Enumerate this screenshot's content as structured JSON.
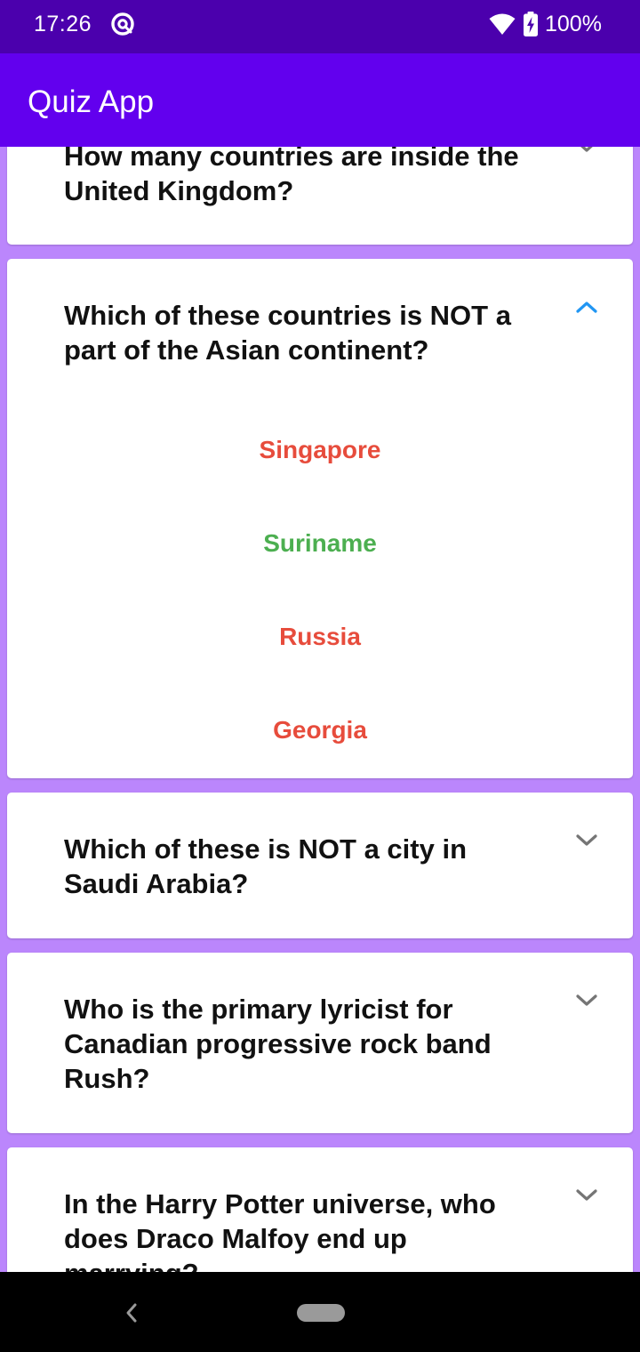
{
  "status_bar": {
    "time": "17:26",
    "battery": "100%",
    "app_icon": "at-sign-icon",
    "wifi_icon": "wifi-icon",
    "battery_icon": "battery-charging-icon"
  },
  "app_bar": {
    "title": "Quiz App"
  },
  "questions": [
    {
      "text": "How many countries are inside the United Kingdom?",
      "expanded": false
    },
    {
      "text": "Which of these countries is NOT a part of the Asian continent?",
      "expanded": true,
      "answers": [
        {
          "text": "Singapore",
          "correct": false
        },
        {
          "text": "Suriname",
          "correct": true
        },
        {
          "text": "Russia",
          "correct": false
        },
        {
          "text": "Georgia",
          "correct": false
        }
      ]
    },
    {
      "text": "Which of these is NOT a city in Saudi Arabia?",
      "expanded": false
    },
    {
      "text": "Who is the primary lyricist for Canadian progressive rock band Rush?",
      "expanded": false
    },
    {
      "text": "In the Harry Potter universe, who does Draco Malfoy end up marrying?",
      "expanded": false
    }
  ],
  "colors": {
    "status_bar": "#4b00ad",
    "app_bar": "#6200ee",
    "background": "#bb86fc",
    "correct": "#4caf50",
    "wrong": "#e74c3c",
    "chevron_expanded": "#2196f3",
    "chevron_collapsed": "#757575"
  },
  "nav_bar": {
    "back_icon": "back-chevron-icon",
    "home_icon": "home-pill-icon"
  }
}
